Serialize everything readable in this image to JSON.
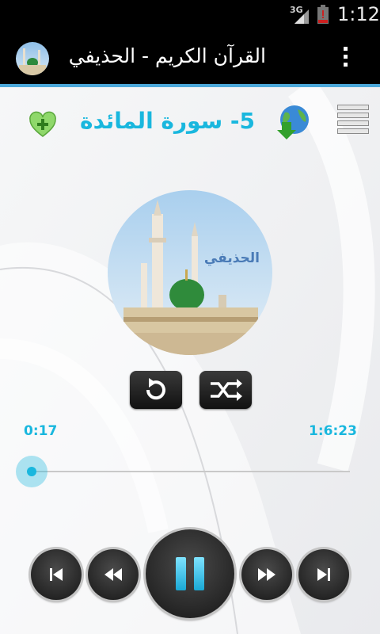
{
  "status_bar": {
    "network": "3G",
    "time": "1:12"
  },
  "action_bar": {
    "title": "القرآن الكريم - الحذيفي",
    "overflow_icon": "overflow-menu-icon"
  },
  "header": {
    "favorite_icon": "heart-add-icon",
    "surah_title": "5- سورة المائدة",
    "download_icon": "globe-download-icon",
    "menu_icon": "list-menu-icon"
  },
  "cover": {
    "reciter_name": "الحذيفي"
  },
  "controls": {
    "repeat_icon": "repeat-icon",
    "shuffle_icon": "shuffle-icon"
  },
  "progress": {
    "current_time": "0:17",
    "total_time": "1:6:23",
    "fraction": 0.004
  },
  "transport": {
    "previous_icon": "skip-previous-icon",
    "rewind_icon": "rewind-icon",
    "pause_icon": "pause-icon",
    "fast_forward_icon": "fast-forward-icon",
    "next_icon": "skip-next-icon"
  },
  "colors": {
    "accent": "#19b7de",
    "action_bar": "#000000",
    "divider": "#4ba8da"
  }
}
